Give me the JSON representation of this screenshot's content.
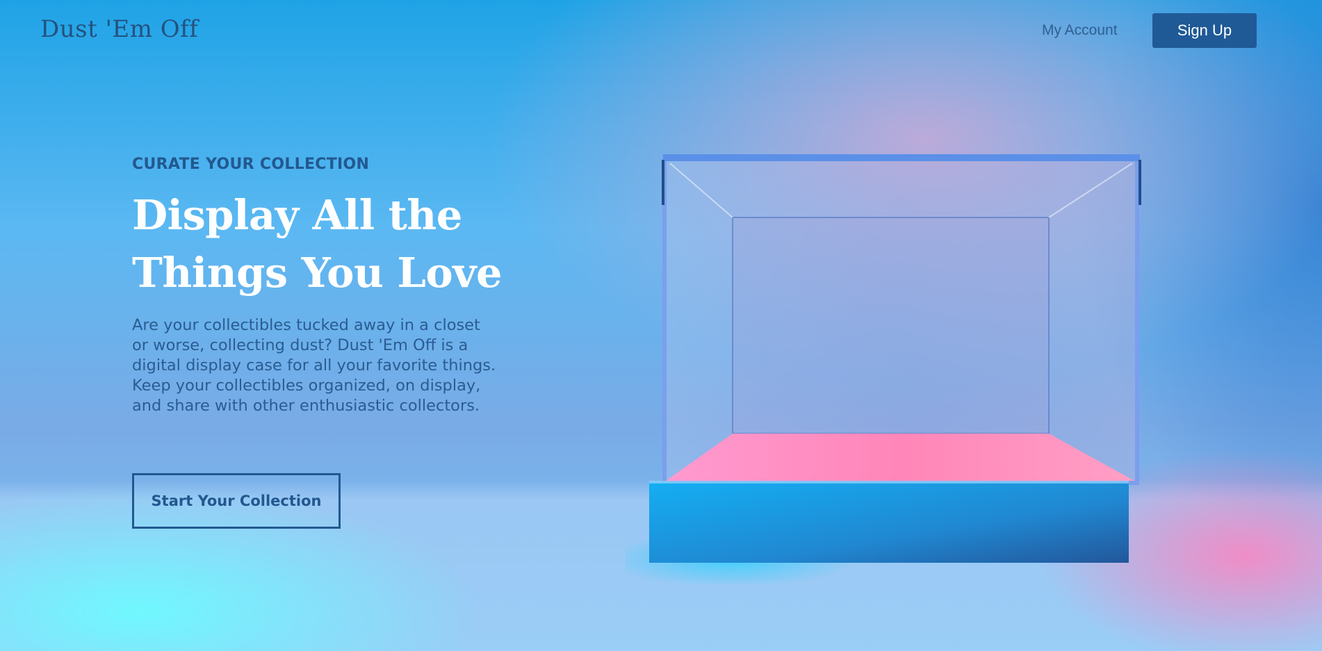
{
  "header": {
    "logo": "Dust 'Em Off",
    "account_link": "My Account",
    "signup_label": "Sign Up"
  },
  "hero": {
    "eyebrow": "CURATE YOUR COLLECTION",
    "headline_line1": "Display All the",
    "headline_line2": "Things You Love",
    "description": "Are your collectibles tucked away in a closet or worse, collecting dust? Dust 'Em Off is a digital display case for all your favorite things. Keep your collectibles organized, on display, and share with other enthusiastic collectors.",
    "cta_label": "Start Your Collection"
  },
  "colors": {
    "brand_dark": "#1f5a97",
    "text_blue": "#22588f",
    "background_blue": "#5bb8f2",
    "glow_pink": "#ff82be",
    "glow_cyan": "#6efaff"
  }
}
